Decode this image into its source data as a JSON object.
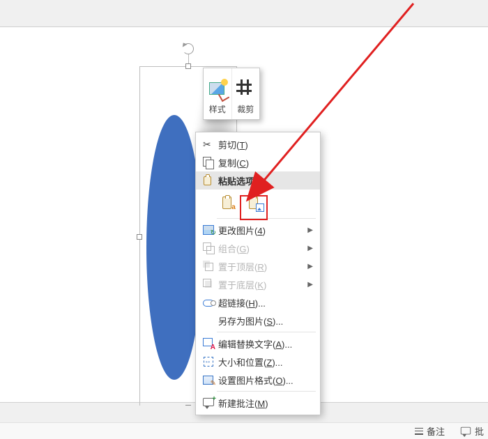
{
  "mini_toolbar": {
    "style_label": "样式",
    "crop_label": "裁剪"
  },
  "menu": {
    "cut": {
      "label": "剪切",
      "accel": "T"
    },
    "copy": {
      "label": "复制",
      "accel": "C"
    },
    "paste_hdr": {
      "label": "粘贴选项:"
    },
    "change_pic": {
      "label": "更改图片",
      "accel": "4"
    },
    "group": {
      "label": "组合",
      "accel": "G"
    },
    "front": {
      "label": "置于顶层",
      "accel": "R"
    },
    "back": {
      "label": "置于底层",
      "accel": "K"
    },
    "link": {
      "label": "超链接",
      "accel": "H"
    },
    "saveas": {
      "label": "另存为图片",
      "accel": "S"
    },
    "alttext": {
      "label": "编辑替换文字",
      "accel": "A"
    },
    "sizepos": {
      "label": "大小和位置",
      "accel": "Z"
    },
    "format": {
      "label": "设置图片格式",
      "accel": "O"
    },
    "comment": {
      "label": "新建批注",
      "accel": "M"
    }
  },
  "statusbar": {
    "notes": "备注",
    "comments_partial": "批"
  },
  "colors": {
    "ellipse": "#3f6fbf",
    "annotation_arrow": "#e02020"
  }
}
